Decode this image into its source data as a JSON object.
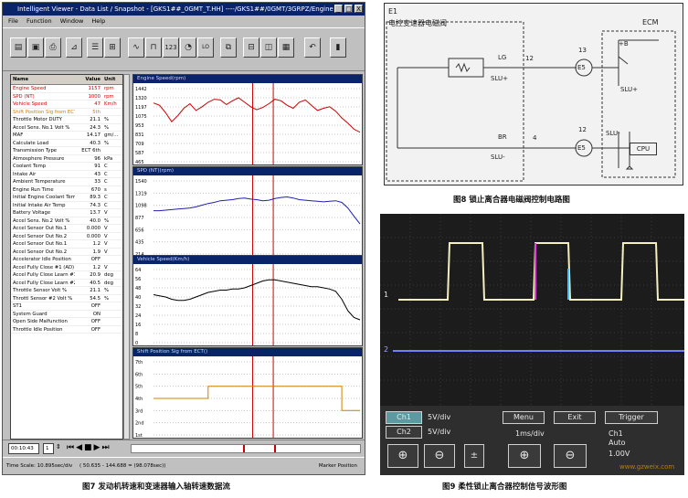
{
  "viewer": {
    "title": "Intelligent Viewer - Data List / Snapshot - [GKS1##_0GMT_T.HH] ----/GKS1##/0GMT/3GRPZ/Engine",
    "window_buttons": [
      "_",
      "□",
      "X"
    ],
    "menu": [
      "File",
      "Function",
      "Window",
      "Help"
    ],
    "toolbar_icons": [
      "open-icon",
      "save-icon",
      "print-icon",
      "graph-icon",
      "list-icon",
      "split-icon",
      "line-graph-icon",
      "digital-icon",
      "numeric-icon",
      "gauge-icon",
      "bulb-icon",
      "graph-2-icon",
      "split-horizontal-icon",
      "split-vertical-icon",
      "tile-icon",
      "undo-icon",
      "exit-icon"
    ],
    "toolbar_text": {
      "numeric": "123",
      "bulb": "LO"
    },
    "table": {
      "headers": [
        "Name",
        "Value",
        "Unit"
      ],
      "rows": [
        [
          "Engine Speed",
          "1157",
          "rpm"
        ],
        [
          "SPD (NT)",
          "1000",
          "rpm"
        ],
        [
          "Vehicle Speed",
          "47",
          "Km/h"
        ],
        [
          "Shift Position Sig from ECT",
          "5th",
          ""
        ],
        [
          "Throttle Motor DUTY",
          "21.1",
          "%"
        ],
        [
          "Accel Sens. No.1 Volt %",
          "24.3",
          "%"
        ],
        [
          "MAF",
          "14.17",
          "gm/..."
        ],
        [
          "Calculate Load",
          "40.3",
          "%"
        ],
        [
          "Transmission Type",
          "ECT 6th",
          ""
        ],
        [
          "Atmosphere Pressure",
          "96",
          "kPa"
        ],
        [
          "Coolant Temp",
          "91",
          "C"
        ],
        [
          "Intake Air",
          "43",
          "C"
        ],
        [
          "Ambient Temperature",
          "33",
          "C"
        ],
        [
          "Engine Run Time",
          "670",
          "s"
        ],
        [
          "Initial Engine Coolant Temp",
          "89.3",
          "C"
        ],
        [
          "Initial Intake Air Temp",
          "74.3",
          "C"
        ],
        [
          "Battery Voltage",
          "13.7",
          "V"
        ],
        [
          "Accel Sens. No.2 Volt %",
          "40.0",
          "%"
        ],
        [
          "Accel Sensor Out No.1",
          "0.000",
          "V"
        ],
        [
          "Accel Sensor Out No.2",
          "0.000",
          "V"
        ],
        [
          "Accel Sensor Out No.1",
          "1.2",
          "V"
        ],
        [
          "Accel Sensor Out No.2",
          "1.9",
          "V"
        ],
        [
          "Accelerator Idle Position",
          "OFF",
          ""
        ],
        [
          "Accel Fully Close #1 (AD)",
          "1.2",
          "V"
        ],
        [
          "Accel Fully Close Learn #1",
          "20.9",
          "deg"
        ],
        [
          "Accel Fully Close Learn #2",
          "40.5",
          "deg"
        ],
        [
          "Throttle Sensor Volt %",
          "21.1",
          "%"
        ],
        [
          "Throttl Sensor #2 Volt %",
          "54.5",
          "%"
        ],
        [
          "ST1",
          "OFF",
          ""
        ],
        [
          "System Guard",
          "ON",
          ""
        ],
        [
          "Open Side Malfunction",
          "OFF",
          ""
        ],
        [
          "Throttle Idle Position",
          "OFF",
          ""
        ]
      ]
    },
    "charts": [
      {
        "title": "Engine Speed(rpm)",
        "ticks": [
          "1442",
          "1320",
          "1197",
          "1075",
          "953",
          "831",
          "709",
          "587",
          "465"
        ]
      },
      {
        "title": "SPD (NT)(rpm)",
        "ticks": [
          "1540",
          "1319",
          "1098",
          "877",
          "656",
          "435",
          "214"
        ]
      },
      {
        "title": "Vehicle Speed(Km/h)",
        "ticks": [
          "64",
          "56",
          "48",
          "40",
          "32",
          "24",
          "16",
          "8",
          "0"
        ]
      },
      {
        "title": "Shift Position Sig from ECT()",
        "ticks": [
          "7th",
          "6th",
          "5th",
          "4th",
          "3rd",
          "2nd",
          "1st"
        ]
      }
    ],
    "chart_data": [
      {
        "type": "line",
        "title": "Engine Speed(rpm)",
        "ylim": [
          465,
          1442
        ],
        "series": [
          {
            "values": [
              1250,
              1220,
              1120,
              1000,
              1080,
              1180,
              1240,
              1150,
              1200,
              1260,
              1300,
              1290,
              1230,
              1280,
              1320,
              1260,
              1200,
              1160,
              1190,
              1240,
              1300,
              1280,
              1220,
              1180,
              1260,
              1290,
              1220,
              1150,
              1180,
              1200,
              1140,
              1050,
              980,
              900,
              860
            ],
            "color": "#cc0000"
          }
        ]
      },
      {
        "type": "line",
        "title": "SPD (NT)(rpm)",
        "ylim": [
          214,
          1540
        ],
        "series": [
          {
            "values": [
              1000,
              1000,
              1010,
              1020,
              1030,
              1040,
              1050,
              1070,
              1100,
              1130,
              1150,
              1180,
              1190,
              1200,
              1220,
              1230,
              1210,
              1200,
              1180,
              1190,
              1220,
              1240,
              1250,
              1230,
              1200,
              1190,
              1180,
              1170,
              1160,
              1170,
              1180,
              1150,
              1050,
              900,
              760
            ],
            "color": "#2020b0"
          }
        ]
      },
      {
        "type": "line",
        "title": "Vehicle Speed(Km/h)",
        "ylim": [
          0,
          64
        ],
        "series": [
          {
            "values": [
              42,
              41,
              40,
              38,
              37,
              37,
              38,
              40,
              42,
              44,
              45,
              46,
              46,
              47,
              47,
              48,
              50,
              52,
              54,
              55,
              55,
              54,
              53,
              52,
              51,
              50,
              49,
              49,
              48,
              47,
              45,
              38,
              28,
              22,
              20
            ],
            "color": "#000000"
          }
        ]
      },
      {
        "type": "line",
        "title": "Shift Position Sig from ECT()",
        "ylim": [
          1,
          7
        ],
        "series": [
          {
            "values": [
              4,
              4,
              4,
              4,
              4,
              4,
              4,
              4,
              4,
              5,
              5,
              5,
              5,
              5,
              5,
              5,
              5,
              5,
              5,
              5,
              5,
              5,
              5,
              5,
              5,
              5,
              5,
              5,
              5,
              5,
              5,
              3,
              3,
              3,
              3
            ],
            "color": "#d08000"
          }
        ]
      }
    ],
    "bottom_bar": {
      "time_field": "00:10:43",
      "stepper": "1"
    },
    "status": {
      "time_scale": "Time Scale:",
      "time_scale_value": "10.895sec/div",
      "range": "( 50.635 - 144.688 = (98.078sec))",
      "marker": "Marker Position"
    }
  },
  "captions": {
    "fig7": "图7 发动机转速和变速器输入轴转速数据流",
    "fig8": "图8 锁止离合器电磁阀控制电路图",
    "fig9": "图9 柔性锁止离合器控制信号波形图"
  },
  "circuit": {
    "box_label": "E1",
    "box_sub": "电控变速器电磁阀",
    "ecm": "ECM",
    "plusb": "+B",
    "lg": "LG",
    "pin12_top": "12",
    "pin13": "13",
    "e5_top": "E5",
    "slu_plus_left": "SLU+",
    "slu_plus_right": "SLU+",
    "br": "BR",
    "pin4": "4",
    "pin12_bottom": "12",
    "e5_bottom": "E5",
    "slu_minus_left": "SLU-",
    "slu_minus_right": "SLU-",
    "cpu": "CPU"
  },
  "scope": {
    "ch1_marker": "1",
    "ch2_marker": "2",
    "ch1_label": "Ch1",
    "ch1_scale": "5V/div",
    "ch2_label": "Ch2",
    "ch2_scale": "5V/div",
    "menu": "Menu",
    "exit": "Exit",
    "trigger": "Trigger",
    "timebase": "1ms/div",
    "trig_source": "Ch1",
    "trig_mode": "Auto",
    "trig_level": "1.00V",
    "watermark": "www.gzweix.com"
  }
}
